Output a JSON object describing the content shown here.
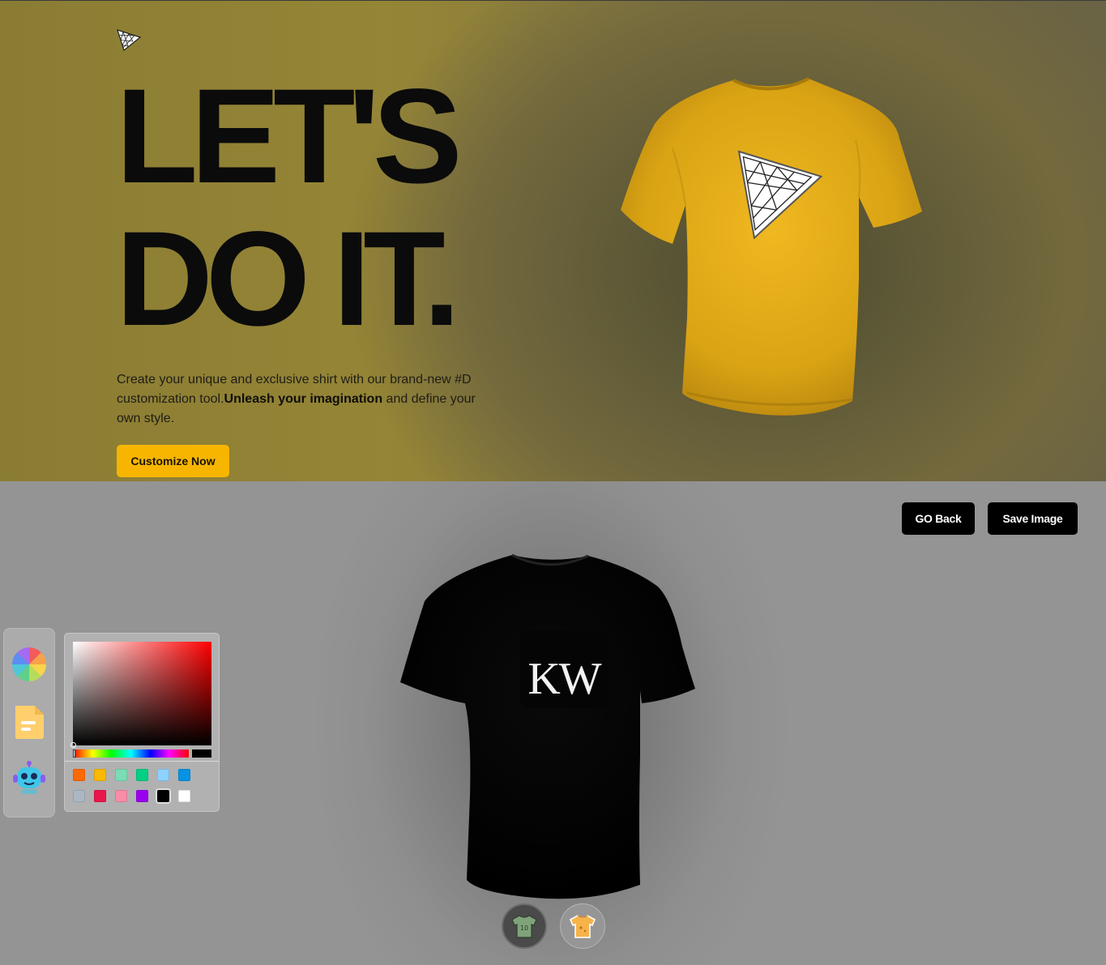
{
  "hero": {
    "headline_line1": "LET'S",
    "headline_line2": "DO IT.",
    "description_part1": "Create your unique and exclusive shirt with our brand-new #D customization tool.",
    "description_bold": "Unleash your imagination",
    "description_part2": " and define your own style.",
    "cta_label": "Customize Now",
    "shirt_color": "#e0a91c",
    "accent_color": "#f7b500"
  },
  "customizer": {
    "go_back_label": "GO Back",
    "save_image_label": "Save Image",
    "shirt_color": "#000000",
    "decal_text": "KW",
    "tabs": [
      {
        "name": "colorpicker",
        "icon": "color-wheel-icon"
      },
      {
        "name": "filepicker",
        "icon": "file-icon"
      },
      {
        "name": "aipicker",
        "icon": "robot-icon"
      }
    ],
    "picker": {
      "selected_color": "#000000",
      "swatches": [
        "#ff6900",
        "#fcb900",
        "#7bdcb5",
        "#00d084",
        "#8ed1fc",
        "#0693e3",
        "#abb8c3",
        "#eb144c",
        "#f78da7",
        "#9900ef",
        "#000000",
        "#ffffff"
      ]
    },
    "filter_tabs": [
      {
        "name": "logoShirt",
        "icon": "logo-shirt-icon",
        "active": true
      },
      {
        "name": "stylishShirt",
        "icon": "stylish-shirt-icon",
        "active": false
      }
    ]
  }
}
